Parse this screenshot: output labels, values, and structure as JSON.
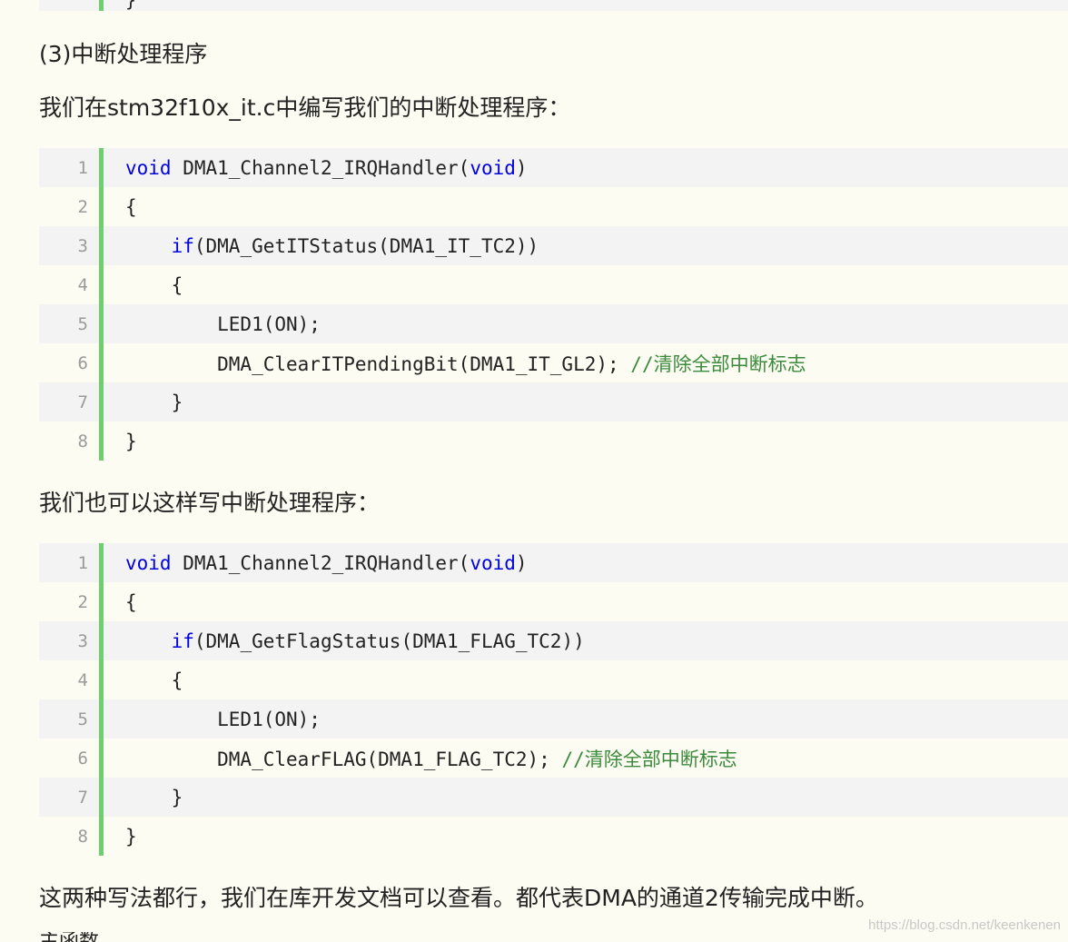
{
  "heading_step3": "(3)中断处理程序",
  "intro_text": "我们在stm32f10x_it.c中编写我们的中断处理程序：",
  "alt_intro_text": "我们也可以这样写中断处理程序：",
  "conclusion_text": "这两种写法都行，我们在库开发文档可以查看。都代表DMA的通道2传输完成中断。",
  "watermark": "https://blog.csdn.net/keenkenen",
  "top_fragment_brace": "}",
  "bottom_cut_text": "    主函数",
  "code_block_1": [
    {
      "n": "1",
      "parts": [
        {
          "t": "kw",
          "v": "void"
        },
        {
          "t": "",
          "v": " DMA1_Channel2_IRQHandler("
        },
        {
          "t": "kw",
          "v": "void"
        },
        {
          "t": "",
          "v": ")"
        }
      ]
    },
    {
      "n": "2",
      "parts": [
        {
          "t": "",
          "v": "{"
        }
      ]
    },
    {
      "n": "3",
      "parts": [
        {
          "t": "",
          "v": "    "
        },
        {
          "t": "kw",
          "v": "if"
        },
        {
          "t": "",
          "v": "(DMA_GetITStatus(DMA1_IT_TC2))"
        }
      ]
    },
    {
      "n": "4",
      "parts": [
        {
          "t": "",
          "v": "    {"
        }
      ]
    },
    {
      "n": "5",
      "parts": [
        {
          "t": "",
          "v": "        LED1(ON);"
        }
      ]
    },
    {
      "n": "6",
      "parts": [
        {
          "t": "",
          "v": "        DMA_ClearITPendingBit(DMA1_IT_GL2); "
        },
        {
          "t": "cm",
          "v": "//清除全部中断标志"
        }
      ]
    },
    {
      "n": "7",
      "parts": [
        {
          "t": "",
          "v": "    }"
        }
      ]
    },
    {
      "n": "8",
      "parts": [
        {
          "t": "",
          "v": "}"
        }
      ]
    }
  ],
  "code_block_2": [
    {
      "n": "1",
      "parts": [
        {
          "t": "kw",
          "v": "void"
        },
        {
          "t": "",
          "v": " DMA1_Channel2_IRQHandler("
        },
        {
          "t": "kw",
          "v": "void"
        },
        {
          "t": "",
          "v": ")"
        }
      ]
    },
    {
      "n": "2",
      "parts": [
        {
          "t": "",
          "v": "{"
        }
      ]
    },
    {
      "n": "3",
      "parts": [
        {
          "t": "",
          "v": "    "
        },
        {
          "t": "kw",
          "v": "if"
        },
        {
          "t": "",
          "v": "(DMA_GetFlagStatus(DMA1_FLAG_TC2))"
        }
      ]
    },
    {
      "n": "4",
      "parts": [
        {
          "t": "",
          "v": "    {"
        }
      ]
    },
    {
      "n": "5",
      "parts": [
        {
          "t": "",
          "v": "        LED1(ON);"
        }
      ]
    },
    {
      "n": "6",
      "parts": [
        {
          "t": "",
          "v": "        DMA_ClearFLAG(DMA1_FLAG_TC2); "
        },
        {
          "t": "cm",
          "v": "//清除全部中断标志"
        }
      ]
    },
    {
      "n": "7",
      "parts": [
        {
          "t": "",
          "v": "    }"
        }
      ]
    },
    {
      "n": "8",
      "parts": [
        {
          "t": "",
          "v": "}"
        }
      ]
    }
  ]
}
